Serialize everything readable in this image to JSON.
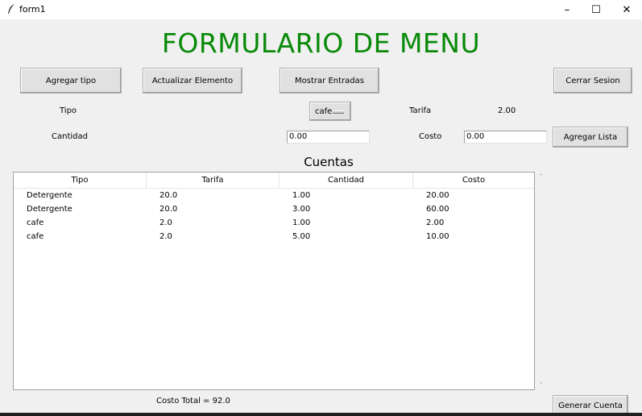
{
  "window": {
    "title": "form1",
    "controls": {
      "minimize": "–",
      "maximize": "☐",
      "close": "✕"
    }
  },
  "heading": "FORMULARIO DE MENU",
  "buttons": {
    "agregar_tipo": "Agregar tipo",
    "actualizar_elemento": "Actualizar Elemento",
    "mostrar_entradas": "Mostrar Entradas",
    "cerrar_sesion": "Cerrar Sesion",
    "agregar_lista": "Agregar Lista",
    "generar_cuenta": "Generar Cuenta"
  },
  "form": {
    "tipo_label": "Tipo",
    "tipo_selected": "cafe",
    "tarifa_label": "Tarifa",
    "tarifa_value": "2.00",
    "cantidad_label": "Cantidad",
    "cantidad_value": "0.00",
    "costo_label": "Costo",
    "costo_value": "0.00"
  },
  "cuentas": {
    "title": "Cuentas",
    "columns": [
      "Tipo",
      "Tarifa",
      "Cantidad",
      "Costo"
    ],
    "rows": [
      [
        "Detergente",
        "20.0",
        "1.00",
        "20.00"
      ],
      [
        "Detergente",
        "20.0",
        "3.00",
        "60.00"
      ],
      [
        "cafe",
        "2.0",
        "1.00",
        "2.00"
      ],
      [
        "cafe",
        "2.0",
        "5.00",
        "10.00"
      ]
    ]
  },
  "total": {
    "label": "Costo Total =",
    "value": "92.0"
  }
}
